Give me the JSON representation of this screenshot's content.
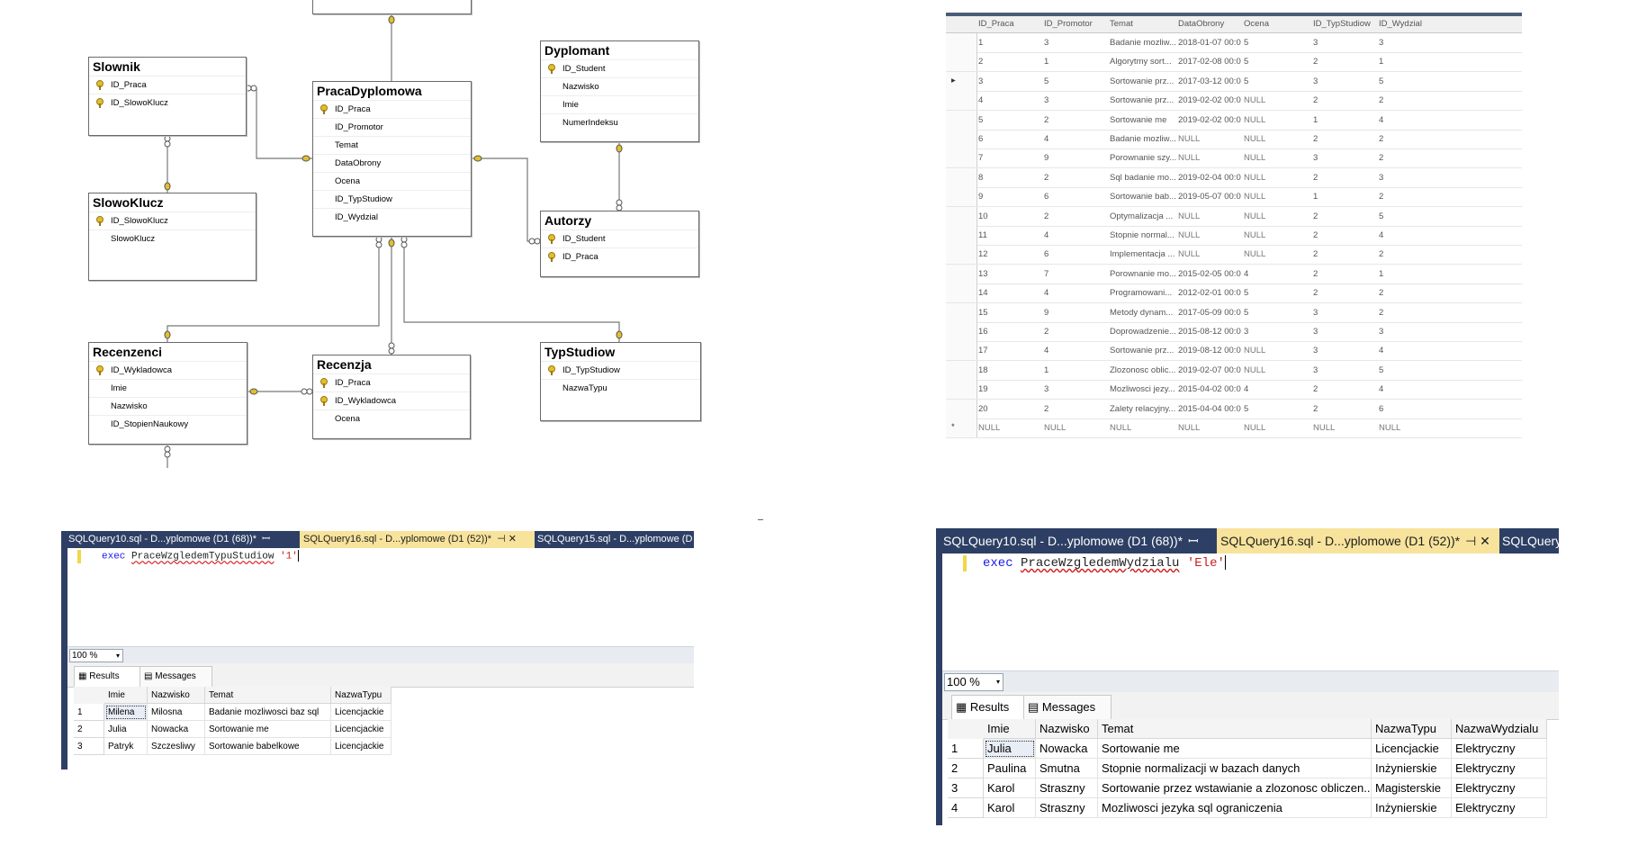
{
  "er_diagram": {
    "tables": [
      {
        "id": "slownik",
        "name": "Slownik",
        "columns": [
          {
            "name": "ID_Praca",
            "key": true
          },
          {
            "name": "ID_SlowoKlucz",
            "key": true
          }
        ]
      },
      {
        "id": "slowoklucz",
        "name": "SlowoKlucz",
        "columns": [
          {
            "name": "ID_SlowoKlucz",
            "key": true
          },
          {
            "name": "SlowoKlucz",
            "key": false
          }
        ]
      },
      {
        "id": "praca",
        "name": "PracaDyplomowa",
        "columns": [
          {
            "name": "ID_Praca",
            "key": true
          },
          {
            "name": "ID_Promotor",
            "key": false
          },
          {
            "name": "Temat",
            "key": false
          },
          {
            "name": "DataObrony",
            "key": false
          },
          {
            "name": "Ocena",
            "key": false
          },
          {
            "name": "ID_TypStudiow",
            "key": false
          },
          {
            "name": "ID_Wydzial",
            "key": false
          }
        ]
      },
      {
        "id": "dyplomant",
        "name": "Dyplomant",
        "columns": [
          {
            "name": "ID_Student",
            "key": true
          },
          {
            "name": "Nazwisko",
            "key": false
          },
          {
            "name": "Imie",
            "key": false
          },
          {
            "name": "NumerIndeksu",
            "key": false
          }
        ]
      },
      {
        "id": "autorzy",
        "name": "Autorzy",
        "columns": [
          {
            "name": "ID_Student",
            "key": true
          },
          {
            "name": "ID_Praca",
            "key": true
          }
        ]
      },
      {
        "id": "recenzenci",
        "name": "Recenzenci",
        "columns": [
          {
            "name": "ID_Wykladowca",
            "key": true
          },
          {
            "name": "Imie",
            "key": false
          },
          {
            "name": "Nazwisko",
            "key": false
          },
          {
            "name": "ID_StopienNaukowy",
            "key": false
          }
        ]
      },
      {
        "id": "recenzja",
        "name": "Recenzja",
        "columns": [
          {
            "name": "ID_Praca",
            "key": true
          },
          {
            "name": "ID_Wykladowca",
            "key": true
          },
          {
            "name": "Ocena",
            "key": false
          }
        ]
      },
      {
        "id": "typstudiow",
        "name": "TypStudiow",
        "columns": [
          {
            "name": "ID_TypStudiow",
            "key": true
          },
          {
            "name": "NazwaTypu",
            "key": false
          }
        ]
      }
    ]
  },
  "data_grid": {
    "columns": [
      "ID_Praca",
      "ID_Promotor",
      "Temat",
      "DataObrony",
      "Ocena",
      "ID_TypStudiow",
      "ID_Wydzial"
    ],
    "current_row_marker": "▸",
    "new_row_marker": "*",
    "rows": [
      [
        "1",
        "3",
        "Badanie mozliw...",
        "2018-01-07 00:0...",
        "5",
        "3",
        "3"
      ],
      [
        "2",
        "1",
        "Algorytmy sort...",
        "2017-02-08 00:0...",
        "5",
        "2",
        "1"
      ],
      [
        "3",
        "5",
        "Sortowanie prz...",
        "2017-03-12 00:0...",
        "5",
        "3",
        "5"
      ],
      [
        "4",
        "3",
        "Sortowanie prz...",
        "2019-02-02 00:0...",
        "NULL",
        "2",
        "2"
      ],
      [
        "5",
        "2",
        "Sortowanie me",
        "2019-02-02 00:0...",
        "NULL",
        "1",
        "4"
      ],
      [
        "6",
        "4",
        "Badanie mozliw...",
        "NULL",
        "NULL",
        "2",
        "2"
      ],
      [
        "7",
        "9",
        "Porownanie szy...",
        "NULL",
        "NULL",
        "3",
        "2"
      ],
      [
        "8",
        "2",
        "Sql badanie mo...",
        "2019-02-04 00:0...",
        "NULL",
        "2",
        "3"
      ],
      [
        "9",
        "6",
        "Sortowanie bab...",
        "2019-05-07 00:0...",
        "NULL",
        "1",
        "2"
      ],
      [
        "10",
        "2",
        "Optymalizacja ...",
        "NULL",
        "NULL",
        "2",
        "5"
      ],
      [
        "11",
        "4",
        "Stopnie normal...",
        "NULL",
        "NULL",
        "2",
        "4"
      ],
      [
        "12",
        "6",
        "Implementacja ...",
        "NULL",
        "NULL",
        "2",
        "2"
      ],
      [
        "13",
        "7",
        "Porownanie mo...",
        "2015-02-05 00:0...",
        "4",
        "2",
        "1"
      ],
      [
        "14",
        "4",
        "Programowani...",
        "2012-02-01 00:0...",
        "5",
        "2",
        "2"
      ],
      [
        "15",
        "9",
        "Metody dynam...",
        "2017-05-09 00:0...",
        "5",
        "3",
        "2"
      ],
      [
        "16",
        "2",
        "Doprowadzenie...",
        "2015-08-12 00:0...",
        "3",
        "3",
        "3"
      ],
      [
        "17",
        "4",
        "Sortowanie prz...",
        "2019-08-12 00:0...",
        "NULL",
        "3",
        "4"
      ],
      [
        "18",
        "1",
        "Zlozonosc oblic...",
        "2019-02-07 00:0...",
        "NULL",
        "3",
        "5"
      ],
      [
        "19",
        "3",
        "Mozliwosci jezy...",
        "2015-04-02 00:0...",
        "4",
        "2",
        "4"
      ],
      [
        "20",
        "2",
        "Zalety relacyjny...",
        "2015-04-04 00:0...",
        "5",
        "2",
        "6"
      ],
      [
        "NULL",
        "NULL",
        "NULL",
        "NULL",
        "NULL",
        "NULL",
        "NULL"
      ]
    ]
  },
  "query_panel_1": {
    "tabs": [
      {
        "label": "SQLQuery10.sql - D...yplomowe (D1 (68))*",
        "icons": "ꟷ",
        "active": false
      },
      {
        "label": "SQLQuery16.sql - D...yplomowe (D1 (52))*",
        "icons": "⊣ ✕",
        "active": true
      },
      {
        "label": "SQLQuery15.sql - D...yplomowe (D",
        "icons": "",
        "active": false
      }
    ],
    "code": {
      "keyword": "exec",
      "procedure": "PraceWzgledemTypuStudiow",
      "argument": "'1'"
    },
    "zoom": "100 %",
    "result_tabs": [
      "Results",
      "Messages"
    ],
    "result_columns": [
      "Imie",
      "Nazwisko",
      "Temat",
      "NazwaTypu"
    ],
    "result_rows": [
      [
        "1",
        "Milena",
        "Milosna",
        "Badanie mozliwosci baz sql",
        "Licencjackie"
      ],
      [
        "2",
        "Julia",
        "Nowacka",
        "Sortowanie me",
        "Licencjackie"
      ],
      [
        "3",
        "Patryk",
        "Szczesliwy",
        "Sortowanie babelkowe",
        "Licencjackie"
      ]
    ]
  },
  "query_panel_2": {
    "tabs": [
      {
        "label": "SQLQuery10.sql - D...yplomowe (D1 (68))*",
        "icons": "ꟷ",
        "active": false
      },
      {
        "label": "SQLQuery16.sql - D...yplomowe (D1 (52))*",
        "icons": "⊣ ✕",
        "active": true
      },
      {
        "label": "SQLQuery",
        "icons": "",
        "active": false
      }
    ],
    "code": {
      "keyword": "exec",
      "procedure": "PraceWzgledemWydzialu",
      "argument": "'Ele'"
    },
    "zoom": "100 %",
    "result_tabs": [
      "Results",
      "Messages"
    ],
    "result_columns": [
      "Imie",
      "Nazwisko",
      "Temat",
      "NazwaTypu",
      "NazwaWydzialu"
    ],
    "result_rows": [
      [
        "1",
        "Julia",
        "Nowacka",
        "Sortowanie me",
        "Licencjackie",
        "Elektryczny"
      ],
      [
        "2",
        "Paulina",
        "Smutna",
        "Stopnie normalizacji w bazach danych",
        "Inżynierskie",
        "Elektryczny"
      ],
      [
        "3",
        "Karol",
        "Straszny",
        "Sortowanie przez wstawianie a zlozonosc obliczen...",
        "Magisterskie",
        "Elektryczny"
      ],
      [
        "4",
        "Karol",
        "Straszny",
        "Mozliwosci jezyka sql ograniczenia",
        "Inżynierskie",
        "Elektryczny"
      ]
    ]
  }
}
